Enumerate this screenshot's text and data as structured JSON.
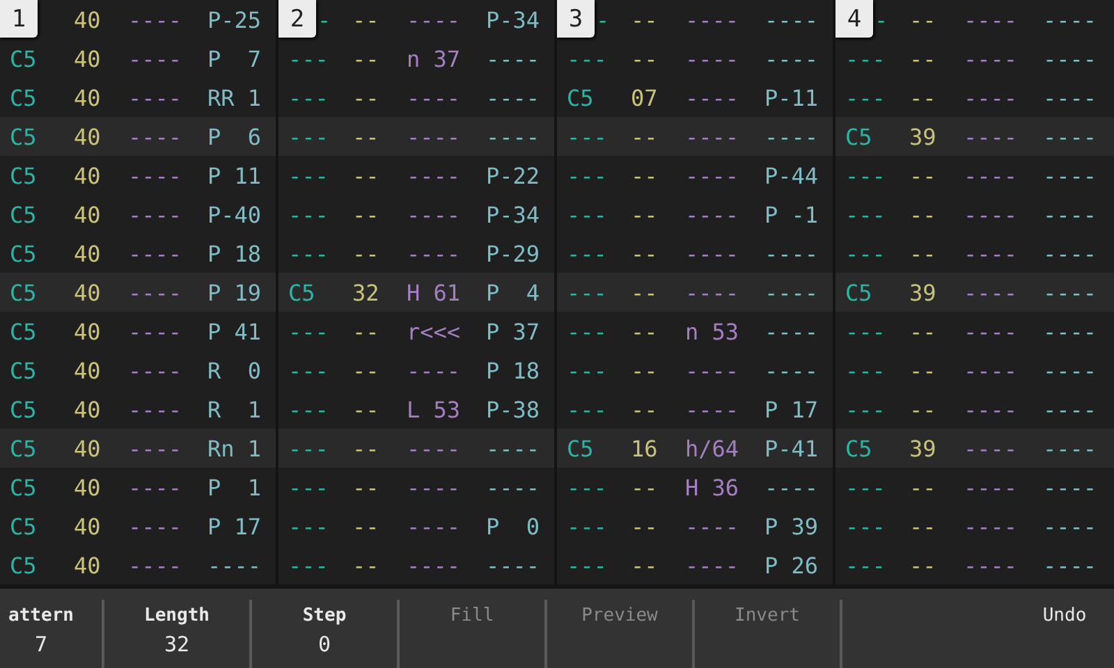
{
  "channels": [
    {
      "number": "1",
      "rows": [
        {
          "vol": "40",
          "fx1": "----",
          "fx2": "P-25"
        },
        {
          "note": "C5",
          "vol": "40",
          "fx1": "----",
          "fx2": "P  7"
        },
        {
          "note": "C5",
          "vol": "40",
          "fx1": "----",
          "fx2": "RR 1"
        },
        {
          "note": "C5",
          "vol": "40",
          "fx1": "----",
          "fx2": "P  6"
        },
        {
          "note": "C5",
          "vol": "40",
          "fx1": "----",
          "fx2": "P 11"
        },
        {
          "note": "C5",
          "vol": "40",
          "fx1": "----",
          "fx2": "P-40"
        },
        {
          "note": "C5",
          "vol": "40",
          "fx1": "----",
          "fx2": "P 18"
        },
        {
          "note": "C5",
          "vol": "40",
          "fx1": "----",
          "fx2": "P 19"
        },
        {
          "note": "C5",
          "vol": "40",
          "fx1": "----",
          "fx2": "P 41"
        },
        {
          "note": "C5",
          "vol": "40",
          "fx1": "----",
          "fx2": "R  0"
        },
        {
          "note": "C5",
          "vol": "40",
          "fx1": "----",
          "fx2": "R  1"
        },
        {
          "note": "C5",
          "vol": "40",
          "fx1": "----",
          "fx2": "Rn 1"
        },
        {
          "note": "C5",
          "vol": "40",
          "fx1": "----",
          "fx2": "P  1"
        },
        {
          "note": "C5",
          "vol": "40",
          "fx1": "----",
          "fx2": "P 17"
        },
        {
          "note": "C5",
          "vol": "40",
          "fx1": "----",
          "fx2": "----"
        }
      ]
    },
    {
      "number": "2",
      "rows": [
        {
          "note": "-",
          "vol": "--",
          "fx1": "----",
          "fx2": "P-34"
        },
        {
          "note": "---",
          "vol": "--",
          "fx1": "n 37",
          "fx2": "----"
        },
        {
          "note": "---",
          "vol": "--",
          "fx1": "----",
          "fx2": "----"
        },
        {
          "note": "---",
          "vol": "--",
          "fx1": "----",
          "fx2": "----"
        },
        {
          "note": "---",
          "vol": "--",
          "fx1": "----",
          "fx2": "P-22"
        },
        {
          "note": "---",
          "vol": "--",
          "fx1": "----",
          "fx2": "P-34"
        },
        {
          "note": "---",
          "vol": "--",
          "fx1": "----",
          "fx2": "P-29"
        },
        {
          "note": "C5",
          "vol": "32",
          "fx1": "H 61",
          "fx2": "P  4"
        },
        {
          "note": "---",
          "vol": "--",
          "fx1": "r<<<",
          "fx2": "P 37"
        },
        {
          "note": "---",
          "vol": "--",
          "fx1": "----",
          "fx2": "P 18"
        },
        {
          "note": "---",
          "vol": "--",
          "fx1": "L 53",
          "fx2": "P-38"
        },
        {
          "note": "---",
          "vol": "--",
          "fx1": "----",
          "fx2": "----"
        },
        {
          "note": "---",
          "vol": "--",
          "fx1": "----",
          "fx2": "----"
        },
        {
          "note": "---",
          "vol": "--",
          "fx1": "----",
          "fx2": "P  0"
        },
        {
          "note": "---",
          "vol": "--",
          "fx1": "----",
          "fx2": "----"
        }
      ]
    },
    {
      "number": "3",
      "rows": [
        {
          "note": "-",
          "vol": "--",
          "fx1": "----",
          "fx2": "----"
        },
        {
          "note": "---",
          "vol": "--",
          "fx1": "----",
          "fx2": "----"
        },
        {
          "note": "C5",
          "vol": "07",
          "fx1": "----",
          "fx2": "P-11"
        },
        {
          "note": "---",
          "vol": "--",
          "fx1": "----",
          "fx2": "----"
        },
        {
          "note": "---",
          "vol": "--",
          "fx1": "----",
          "fx2": "P-44"
        },
        {
          "note": "---",
          "vol": "--",
          "fx1": "----",
          "fx2": "P -1"
        },
        {
          "note": "---",
          "vol": "--",
          "fx1": "----",
          "fx2": "----"
        },
        {
          "note": "---",
          "vol": "--",
          "fx1": "----",
          "fx2": "----"
        },
        {
          "note": "---",
          "vol": "--",
          "fx1": "n 53",
          "fx2": "----"
        },
        {
          "note": "---",
          "vol": "--",
          "fx1": "----",
          "fx2": "----"
        },
        {
          "note": "---",
          "vol": "--",
          "fx1": "----",
          "fx2": "P 17"
        },
        {
          "note": "C5",
          "vol": "16",
          "fx1": "h/64",
          "fx2": "P-41"
        },
        {
          "note": "---",
          "vol": "--",
          "fx1": "H 36",
          "fx2": "----"
        },
        {
          "note": "---",
          "vol": "--",
          "fx1": "----",
          "fx2": "P 39"
        },
        {
          "note": "---",
          "vol": "--",
          "fx1": "----",
          "fx2": "P 26"
        }
      ]
    },
    {
      "number": "4",
      "rows": [
        {
          "note": "-",
          "vol": "--",
          "fx1": "----",
          "fx2": "----"
        },
        {
          "note": "---",
          "vol": "--",
          "fx1": "----",
          "fx2": "----"
        },
        {
          "note": "---",
          "vol": "--",
          "fx1": "----",
          "fx2": "----"
        },
        {
          "note": "C5",
          "vol": "39",
          "fx1": "----",
          "fx2": "----"
        },
        {
          "note": "---",
          "vol": "--",
          "fx1": "----",
          "fx2": "----"
        },
        {
          "note": "---",
          "vol": "--",
          "fx1": "----",
          "fx2": "----"
        },
        {
          "note": "---",
          "vol": "--",
          "fx1": "----",
          "fx2": "----"
        },
        {
          "note": "C5",
          "vol": "39",
          "fx1": "----",
          "fx2": "----"
        },
        {
          "note": "---",
          "vol": "--",
          "fx1": "----",
          "fx2": "----"
        },
        {
          "note": "---",
          "vol": "--",
          "fx1": "----",
          "fx2": "----"
        },
        {
          "note": "---",
          "vol": "--",
          "fx1": "----",
          "fx2": "----"
        },
        {
          "note": "C5",
          "vol": "39",
          "fx1": "----",
          "fx2": "----"
        },
        {
          "note": "---",
          "vol": "--",
          "fx1": "----",
          "fx2": "----"
        },
        {
          "note": "---",
          "vol": "--",
          "fx1": "----",
          "fx2": "----"
        },
        {
          "note": "---",
          "vol": "--",
          "fx1": "----",
          "fx2": "----"
        }
      ]
    }
  ],
  "toolbar": [
    {
      "kind": "value",
      "label": "attern",
      "value": "7",
      "disabled": false
    },
    {
      "kind": "value",
      "label": "Length",
      "value": "32",
      "disabled": false
    },
    {
      "kind": "value",
      "label": "Step",
      "value": "0",
      "disabled": false
    },
    {
      "kind": "action",
      "label": "Fill",
      "disabled": true
    },
    {
      "kind": "action",
      "label": "Preview",
      "disabled": true
    },
    {
      "kind": "action",
      "label": "Invert",
      "disabled": true
    },
    {
      "kind": "action",
      "label": "Undo",
      "disabled": false
    }
  ]
}
